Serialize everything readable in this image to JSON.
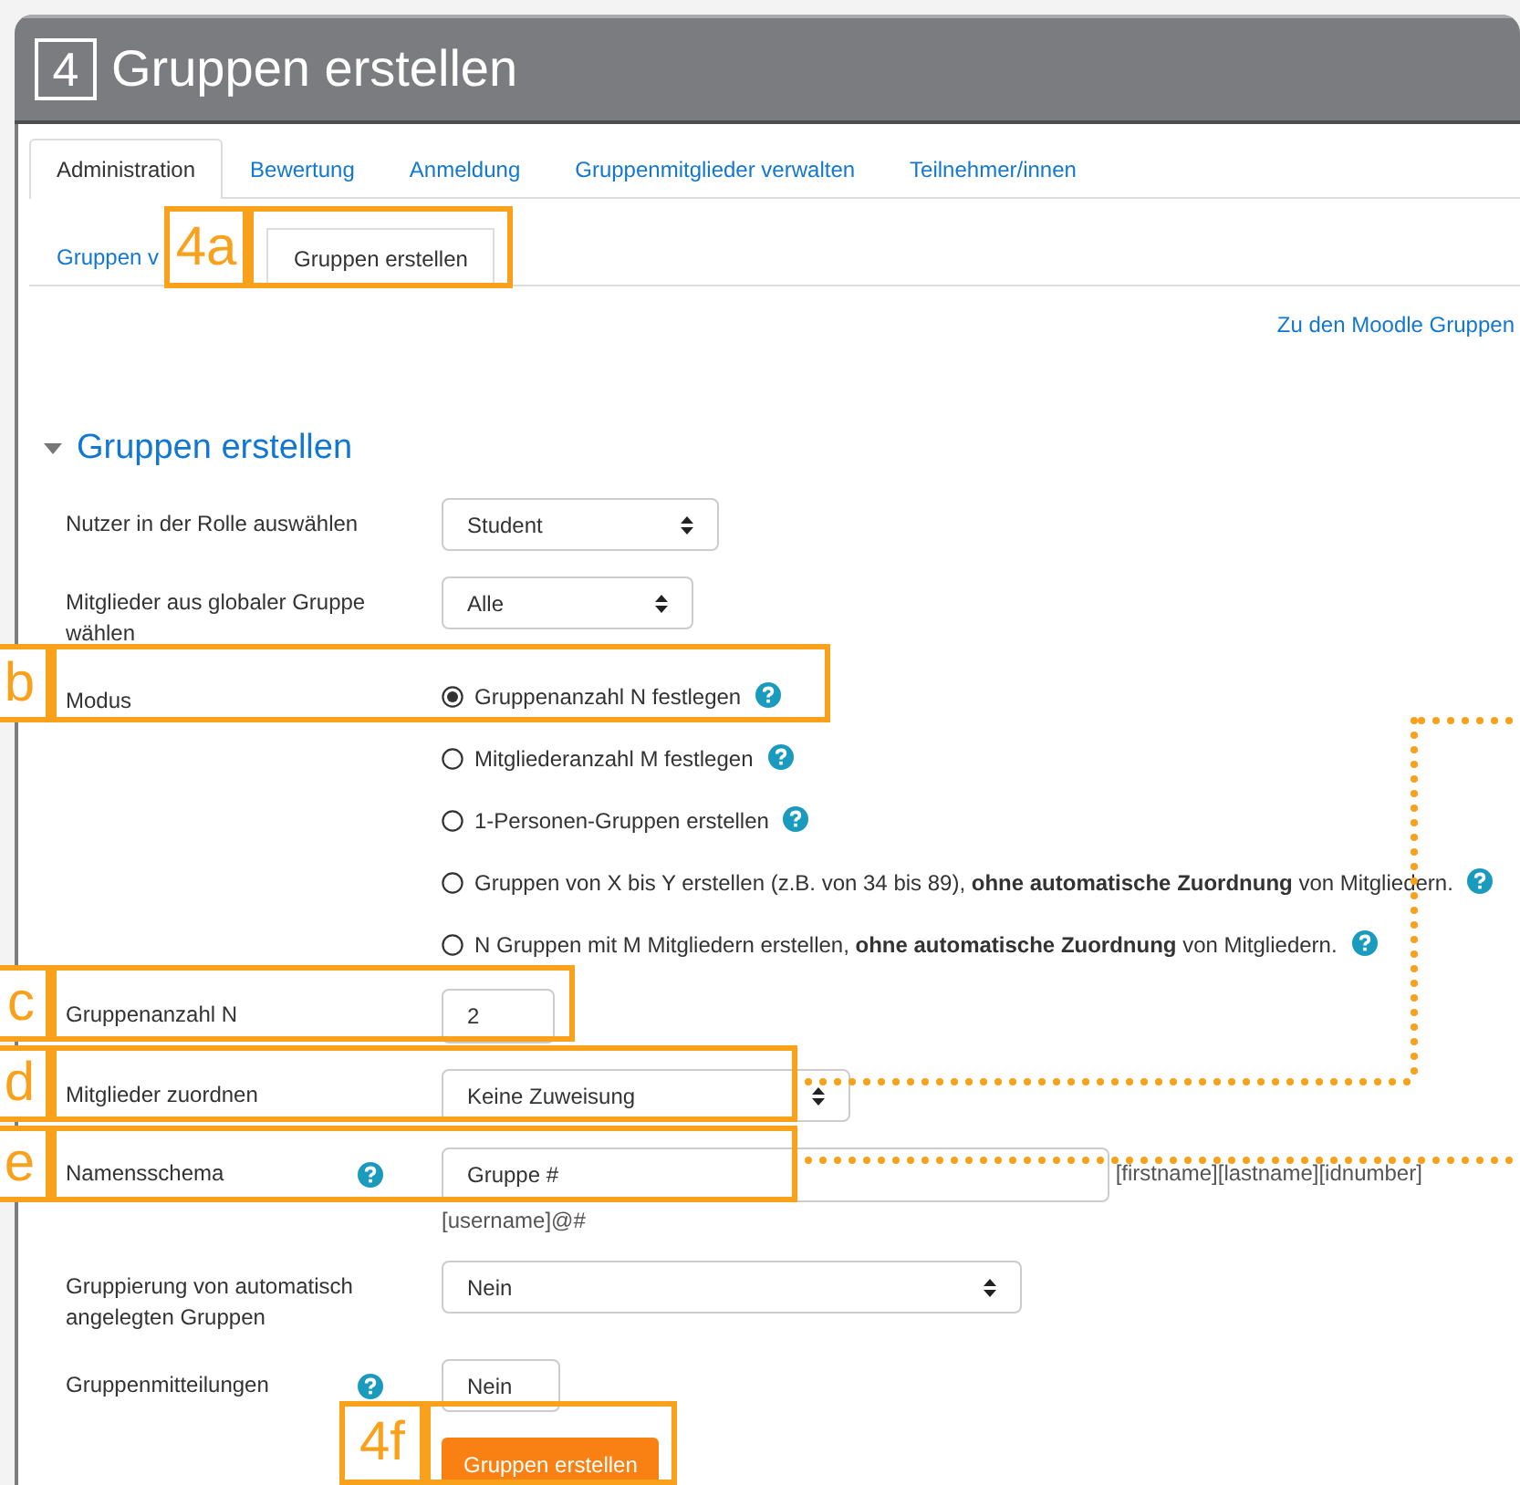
{
  "window": {
    "number": "4",
    "title": "Gruppen erstellen"
  },
  "tabs": [
    {
      "label": "Administration",
      "selected": true
    },
    {
      "label": "Bewertung",
      "selected": false
    },
    {
      "label": "Anmeldung",
      "selected": false
    },
    {
      "label": "Gruppenmitglieder verwalten",
      "selected": false
    },
    {
      "label": "Teilnehmer/innen",
      "selected": false
    }
  ],
  "subtabs": [
    {
      "label": "Gruppen v",
      "selected": false
    },
    {
      "label": "Gruppen erstellen",
      "selected": true
    }
  ],
  "moodle_link": "Zu den Moodle Gruppen",
  "section": {
    "title": "Gruppen erstellen",
    "expanded": true
  },
  "form": [
    {
      "kind": "select",
      "label": "Nutzer in der Rolle auswählen",
      "value": "Student",
      "help": false
    },
    {
      "kind": "select",
      "label": "Mitglieder aus globaler Gruppe wählen",
      "value": "Alle",
      "help": false
    },
    {
      "kind": "radios",
      "label": "Modus",
      "help": false,
      "options": [
        {
          "label": "Gruppenanzahl N festlegen",
          "selected": true
        },
        {
          "label": "Mitgliederanzahl M festlegen",
          "selected": false
        },
        {
          "label": "1-Personen-Gruppen erstellen",
          "selected": false
        },
        {
          "label": "Gruppen von X bis Y erstellen (z.B. von 34 bis 89), **ohne automatische Zuordnung** von Mitgliedern.",
          "selected": false
        },
        {
          "label": "N Gruppen mit M Mitgliedern erstellen, **ohne automatische Zuordnung** von Mitgliedern.",
          "selected": false
        }
      ]
    },
    {
      "kind": "text",
      "label": "Gruppenanzahl N",
      "value": "2",
      "help": false
    },
    {
      "kind": "select",
      "label": "Mitglieder zuordnen",
      "value": "Keine Zuweisung",
      "help": false
    },
    {
      "kind": "text",
      "label": "Namensschema",
      "value": "Gruppe #",
      "help": true,
      "hint": [
        "[firstname][lastname][idnumber]",
        "[username]@#"
      ]
    },
    {
      "kind": "select",
      "label": "Gruppierung von automatisch angelegten Gruppen",
      "value": "Nein",
      "help": false
    },
    {
      "kind": "select",
      "label": "Gruppenmitteilungen",
      "value": "Nein",
      "help": true
    }
  ],
  "submit": "Gruppen erstellen",
  "annotations": [
    {
      "label": "4a"
    },
    {
      "label": "b"
    },
    {
      "label": "c"
    },
    {
      "label": "d"
    },
    {
      "label": "e"
    },
    {
      "label": "4f"
    }
  ]
}
